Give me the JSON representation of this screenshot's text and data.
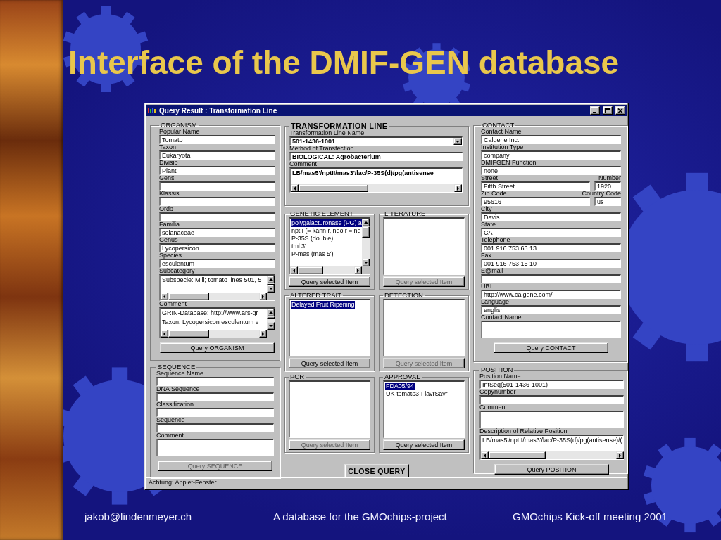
{
  "slide": {
    "title": "Interface of the DMIF-GEN database",
    "footer": [
      "jakob@lindenmeyer.ch",
      "A database for the GMOchips-project",
      "GMOchips Kick-off meeting 2001"
    ]
  },
  "window": {
    "title": "Query Result : Transformation Line",
    "status_bar": "Achtung: Applet-Fenster",
    "close_button": {
      "label": "CLOSE QUERY",
      "disabled": false
    }
  },
  "organism": {
    "title": "ORGANISM",
    "fields": [
      {
        "kind": "text",
        "label": "Popular Name",
        "value": "Tomato"
      },
      {
        "kind": "text",
        "label": "Taxon",
        "value": "Eukaryota"
      },
      {
        "kind": "text",
        "label": "Divisio",
        "value": "Plant"
      },
      {
        "kind": "text",
        "label": "Gens"
      },
      {
        "kind": "text",
        "label": "Klassis"
      },
      {
        "kind": "text",
        "label": "Ordo"
      },
      {
        "kind": "text",
        "label": "Familia",
        "value": "solanaceae"
      },
      {
        "kind": "text",
        "label": "Genus",
        "value": "Lycopersicon"
      },
      {
        "kind": "text",
        "label": "Species",
        "value": "esculentum"
      },
      {
        "kind": "memo",
        "label": "Subcategory",
        "lines": [
          "Subspecie: Mill; tomato lines 501, 5"
        ],
        "vscroll": true,
        "hscroll": true
      },
      {
        "kind": "memo",
        "label": "Comment",
        "lines": [
          "GRIN-Database: http://www.ars-gr",
          "Taxon: Lycopersicon esculentum v"
        ],
        "vscroll": true,
        "hscroll": true
      }
    ],
    "button": {
      "label": "Query ORGANISM",
      "disabled": false
    }
  },
  "sequence": {
    "title": "SEQUENCE",
    "fields": [
      {
        "kind": "text",
        "label": "Sequence Name"
      },
      {
        "kind": "text",
        "label": "DNA Sequence"
      },
      {
        "kind": "text",
        "label": "Classification"
      },
      {
        "kind": "text",
        "label": "Sequence"
      },
      {
        "kind": "memo",
        "label": "Comment"
      }
    ],
    "button": {
      "label": "Query SEQUENCE",
      "disabled": true
    }
  },
  "transformation_line": {
    "title": "TRANSFORMATION LINE",
    "fields": [
      {
        "kind": "combo",
        "label": "Transformation Line Name",
        "value": "501-1436-1001",
        "bold": true
      },
      {
        "kind": "text",
        "label": "Method of Transfection",
        "value": "BIOLOGICAL: Agrobacterium",
        "bold": true
      },
      {
        "kind": "memo",
        "label": "Comment",
        "lines": [
          "LB/mas5'/nptII/mas3'/lac/P-35S(d)/pg(antisense"
        ],
        "hscroll": true,
        "bold": true
      }
    ]
  },
  "lists": [
    {
      "title": "GENETIC ELEMENT",
      "scrollbars": true,
      "items": [
        {
          "text": "polygalacturonase (PG) a",
          "selected": true
        },
        {
          "text": "nptII (= kann r, neo r = ne",
          "selected": false
        },
        {
          "text": "P-35S (double)",
          "selected": false
        },
        {
          "text": "tml 3'",
          "selected": false
        },
        {
          "text": "P-mas (mas 5')",
          "selected": false
        }
      ],
      "button": {
        "label": "Query selected Item",
        "disabled": false
      }
    },
    {
      "title": "LITERATURE",
      "button": {
        "label": "Query selected Item",
        "disabled": true
      }
    },
    {
      "title": "ALTERED TRAIT",
      "items": [
        {
          "text": "Delayed Fruit Ripening",
          "selected": true
        }
      ],
      "button": {
        "label": "Query selected Item",
        "disabled": false
      }
    },
    {
      "title": "DETECTION",
      "button": {
        "label": "Query selected Item",
        "disabled": true
      }
    },
    {
      "title": "PCR",
      "button": {
        "label": "Query selected Item",
        "disabled": true
      }
    },
    {
      "title": "APPROVAL",
      "items": [
        {
          "text": "FDA05/94",
          "selected": true
        },
        {
          "text": "UK-tomato3-FlavrSavr",
          "selected": false
        }
      ],
      "button": {
        "label": "Query selected Item",
        "disabled": false
      }
    }
  ],
  "contact": {
    "title": "CONTACT",
    "fields": [
      {
        "kind": "text",
        "label": "Contact Name",
        "value": "Calgene Inc."
      },
      {
        "kind": "text",
        "label": "Institution Type",
        "value": "company"
      },
      {
        "kind": "text",
        "label": "DMIFGEN Function",
        "value": "none"
      },
      {
        "kind": "pair",
        "items": [
          {
            "label": "Street",
            "value": "Fifth Street"
          },
          {
            "label": "Number",
            "value": "1920"
          }
        ]
      },
      {
        "kind": "pair",
        "items": [
          {
            "label": "Zip Code",
            "value": "95616"
          },
          {
            "label": "Country Code",
            "value": "us"
          }
        ]
      },
      {
        "kind": "text",
        "label": "City",
        "value": "Davis"
      },
      {
        "kind": "text",
        "label": "State",
        "value": "CA"
      },
      {
        "kind": "text",
        "label": "Telephone",
        "value": "001 916 753 63 13"
      },
      {
        "kind": "text",
        "label": "Fax",
        "value": "001 916 753 15 10"
      },
      {
        "kind": "text",
        "label": "E@mail"
      },
      {
        "kind": "text",
        "label": "URL",
        "value": "http://www.calgene.com/"
      },
      {
        "kind": "text",
        "label": "Language",
        "value": "english"
      },
      {
        "kind": "memo",
        "label": "Contact Name"
      }
    ],
    "button": {
      "label": "Query CONTACT",
      "disabled": false
    }
  },
  "position": {
    "title": "POSITION",
    "fields": [
      {
        "kind": "text",
        "label": "Position Name",
        "value": "IntSeq(501-1436-1001)"
      },
      {
        "kind": "text",
        "label": "Copynumber"
      },
      {
        "kind": "memo",
        "label": "Comment"
      },
      {
        "kind": "memo",
        "label": "Description of Relative Position",
        "lines": [
          "LB/mas5'/nptII/mas3'/lac/P-35S(d)/pg(antisense)/("
        ],
        "hscroll": true
      }
    ],
    "button": {
      "label": "Query POSITION",
      "disabled": false
    }
  }
}
